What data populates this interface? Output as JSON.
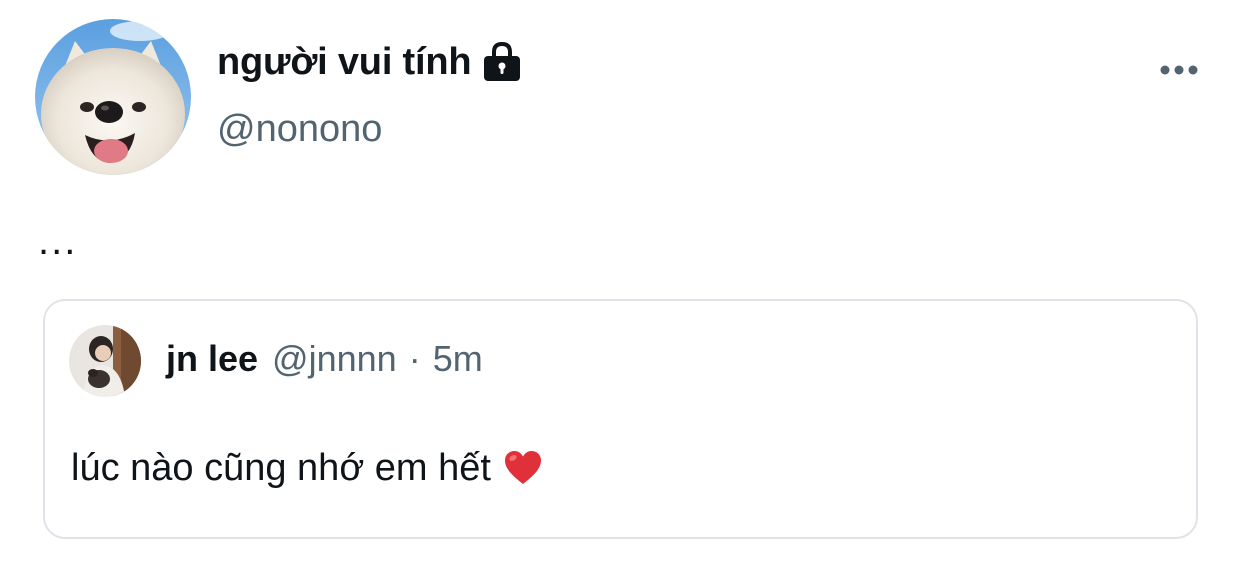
{
  "author": {
    "display_name": "người vui tính",
    "handle": "@nonono",
    "protected_icon": "lock-icon",
    "avatar": "samoyed-dog-photo"
  },
  "menu": {
    "more_icon": "more-options-icon"
  },
  "tweet": {
    "text": "..."
  },
  "quote": {
    "display_name": "jn lee",
    "handle": "@jnnnn",
    "separator": "·",
    "time": "5m",
    "text": "lúc nào cũng nhớ em hết",
    "emoji_icon": "red-heart-icon",
    "avatar": "person-photo"
  },
  "colors": {
    "text_primary": "#0f1419",
    "text_secondary": "#536471",
    "card_border": "#dfe3e8",
    "heart": "#e0303a"
  }
}
